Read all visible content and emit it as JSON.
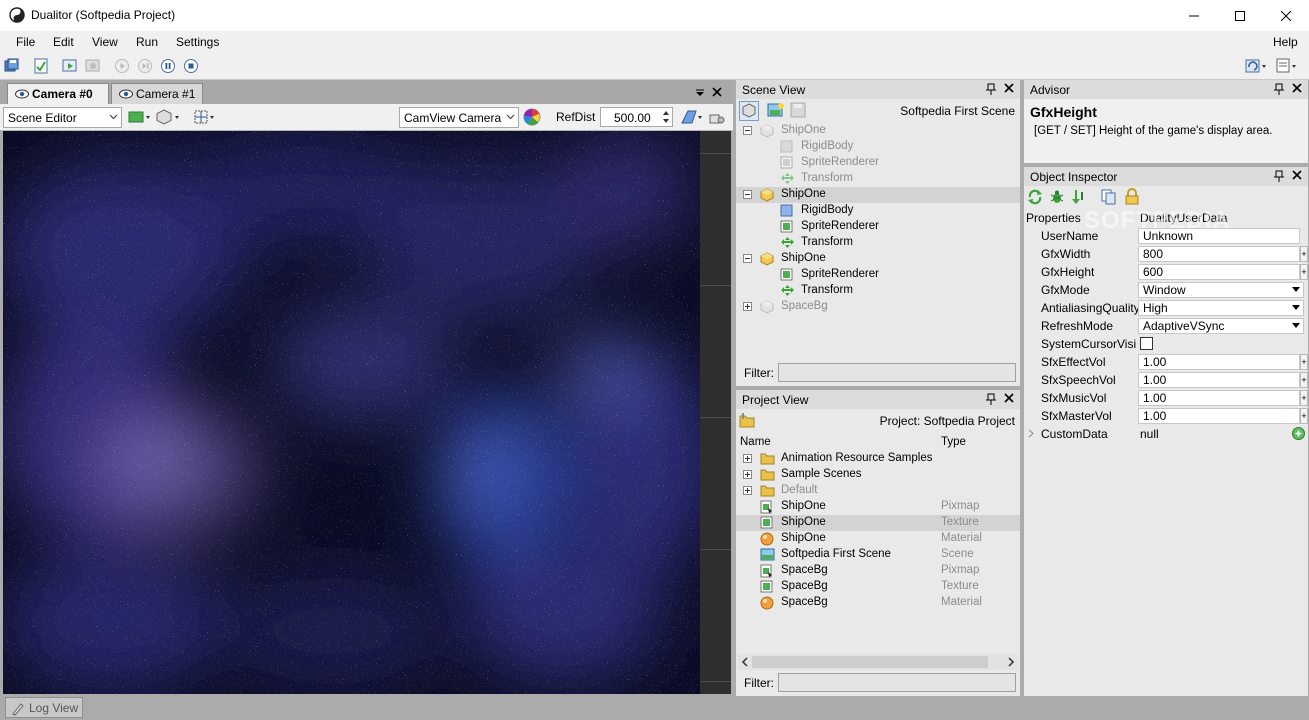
{
  "window": {
    "title": "Dualitor (Softpedia Project)"
  },
  "menu": {
    "file": "File",
    "edit": "Edit",
    "view": "View",
    "run": "Run",
    "settings": "Settings",
    "help": "Help"
  },
  "camera_tabs": [
    {
      "label": "Camera #0"
    },
    {
      "label": "Camera #1"
    }
  ],
  "cam_toolbar": {
    "mode": "Scene Editor",
    "camera": "CamView Camera",
    "refdist_label": "RefDist",
    "refdist_value": "500.00"
  },
  "scene_view": {
    "title": "Scene View",
    "scene_name": "Softpedia First Scene",
    "tree": [
      {
        "label": "ShipOne",
        "level": 0,
        "expander": "-",
        "icon": "object",
        "dim": true
      },
      {
        "label": "RigidBody",
        "level": 1,
        "icon": "rigidbody",
        "dim": true
      },
      {
        "label": "SpriteRenderer",
        "level": 1,
        "icon": "sprite",
        "dim": true
      },
      {
        "label": "Transform",
        "level": 1,
        "icon": "transform",
        "dim": true
      },
      {
        "label": "ShipOne",
        "level": 0,
        "expander": "-",
        "icon": "object",
        "dim": false,
        "selected": true
      },
      {
        "label": "RigidBody",
        "level": 1,
        "icon": "rigidbody",
        "dim": false
      },
      {
        "label": "SpriteRenderer",
        "level": 1,
        "icon": "sprite",
        "dim": false
      },
      {
        "label": "Transform",
        "level": 1,
        "icon": "transform",
        "dim": false
      },
      {
        "label": "ShipOne",
        "level": 0,
        "expander": "-",
        "icon": "object",
        "dim": false
      },
      {
        "label": "SpriteRenderer",
        "level": 1,
        "icon": "sprite",
        "dim": false
      },
      {
        "label": "Transform",
        "level": 1,
        "icon": "transform",
        "dim": false
      },
      {
        "label": "SpaceBg",
        "level": 0,
        "expander": "+",
        "icon": "object",
        "dim": true
      }
    ],
    "filter_label": "Filter:"
  },
  "project_view": {
    "title": "Project View",
    "project_name": "Project: Softpedia Project",
    "col_name": "Name",
    "col_type": "Type",
    "items": [
      {
        "label": "Animation Resource Samples",
        "type": "",
        "icon": "folder",
        "expander": "+"
      },
      {
        "label": "Sample Scenes",
        "type": "",
        "icon": "folder",
        "expander": "+"
      },
      {
        "label": "Default",
        "type": "",
        "icon": "folder",
        "expander": "+",
        "dim": true
      },
      {
        "label": "ShipOne",
        "type": "Pixmap",
        "icon": "pixmap"
      },
      {
        "label": "ShipOne",
        "type": "Texture",
        "icon": "texture",
        "selected": true
      },
      {
        "label": "ShipOne",
        "type": "Material",
        "icon": "material"
      },
      {
        "label": "Softpedia First Scene",
        "type": "Scene",
        "icon": "scene"
      },
      {
        "label": "SpaceBg",
        "type": "Pixmap",
        "icon": "pixmap"
      },
      {
        "label": "SpaceBg",
        "type": "Texture",
        "icon": "texture"
      },
      {
        "label": "SpaceBg",
        "type": "Material",
        "icon": "material"
      }
    ],
    "filter_label": "Filter:"
  },
  "advisor": {
    "title": "Advisor",
    "heading": "GfxHeight",
    "text": "[GET / SET] Height of the game's display area."
  },
  "inspector": {
    "title": "Object Inspector",
    "header_left": "Properties",
    "header_right": "DualityUserData",
    "watermark": "SOFTPEDIA",
    "props": [
      {
        "name": "UserName",
        "value": "Unknown",
        "kind": "text"
      },
      {
        "name": "GfxWidth",
        "value": "800",
        "kind": "spin"
      },
      {
        "name": "GfxHeight",
        "value": "600",
        "kind": "spin"
      },
      {
        "name": "GfxMode",
        "value": "Window",
        "kind": "dropdown"
      },
      {
        "name": "AntialiasingQuality",
        "value": "High",
        "kind": "dropdown"
      },
      {
        "name": "RefreshMode",
        "value": "AdaptiveVSync",
        "kind": "dropdown"
      },
      {
        "name": "SystemCursorVisi",
        "value": "",
        "kind": "checkbox"
      },
      {
        "name": "SfxEffectVol",
        "value": "1.00",
        "kind": "spin"
      },
      {
        "name": "SfxSpeechVol",
        "value": "1.00",
        "kind": "spin"
      },
      {
        "name": "SfxMusicVol",
        "value": "1.00",
        "kind": "spin"
      },
      {
        "name": "SfxMasterVol",
        "value": "1.00",
        "kind": "spin"
      },
      {
        "name": "CustomData",
        "value": "null",
        "kind": "expandable"
      }
    ]
  },
  "status": {
    "log_view": "Log View"
  },
  "colors": {
    "accent_green": "#3aa63a",
    "folder": "#e8c24a",
    "selected_row": "#d3d3d3",
    "viewport_deep": "#0b0c24"
  }
}
